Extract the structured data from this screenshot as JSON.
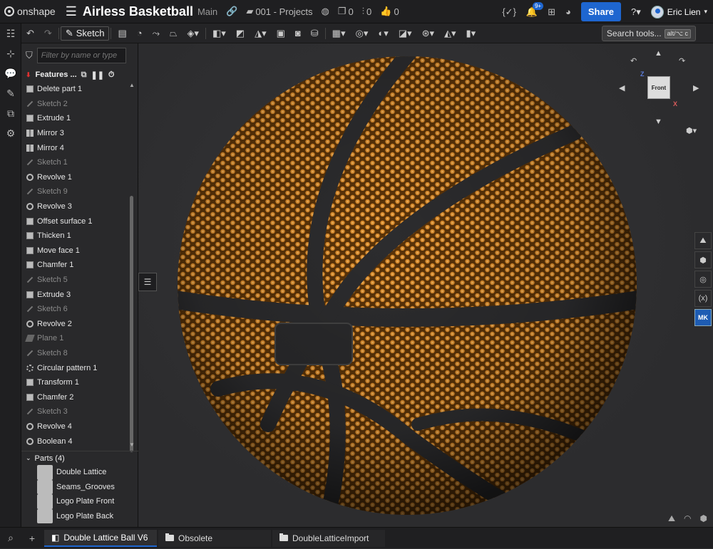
{
  "topbar": {
    "brand": "onshape",
    "doc_title": "Airless Basketball",
    "branch": "Main",
    "project": "001 - Projects",
    "counts": {
      "copies": "0",
      "versions": "0",
      "likes": "0"
    },
    "notifications": "9+",
    "share_label": "Share",
    "user_name": "Eric Lien"
  },
  "toolbar": {
    "sketch_label": "Sketch",
    "search_label": "Search tools...",
    "search_shortcut": "alt/⌥ c"
  },
  "panel": {
    "filter_placeholder": "Filter by name or type",
    "features_label": "Features ...",
    "features": [
      {
        "label": "Delete part 1",
        "type": "extrude",
        "dim": false
      },
      {
        "label": "Sketch 2",
        "type": "sketch",
        "dim": true
      },
      {
        "label": "Extrude 1",
        "type": "extrude",
        "dim": false
      },
      {
        "label": "Mirror 3",
        "type": "mirror",
        "dim": false
      },
      {
        "label": "Mirror 4",
        "type": "mirror",
        "dim": false
      },
      {
        "label": "Sketch 1",
        "type": "sketch",
        "dim": true
      },
      {
        "label": "Revolve 1",
        "type": "revolve",
        "dim": false
      },
      {
        "label": "Sketch 9",
        "type": "sketch",
        "dim": true
      },
      {
        "label": "Revolve 3",
        "type": "revolve",
        "dim": false
      },
      {
        "label": "Offset surface 1",
        "type": "extrude",
        "dim": false
      },
      {
        "label": "Thicken 1",
        "type": "extrude",
        "dim": false
      },
      {
        "label": "Move face 1",
        "type": "extrude",
        "dim": false
      },
      {
        "label": "Chamfer 1",
        "type": "extrude",
        "dim": false
      },
      {
        "label": "Sketch 5",
        "type": "sketch",
        "dim": true
      },
      {
        "label": "Extrude 3",
        "type": "extrude",
        "dim": false
      },
      {
        "label": "Sketch 6",
        "type": "sketch",
        "dim": true
      },
      {
        "label": "Revolve 2",
        "type": "revolve",
        "dim": false
      },
      {
        "label": "Plane 1",
        "type": "plane",
        "dim": true
      },
      {
        "label": "Sketch 8",
        "type": "sketch",
        "dim": true
      },
      {
        "label": "Circular pattern 1",
        "type": "pattern",
        "dim": false
      },
      {
        "label": "Transform 1",
        "type": "extrude",
        "dim": false
      },
      {
        "label": "Chamfer 2",
        "type": "extrude",
        "dim": false
      },
      {
        "label": "Sketch 3",
        "type": "sketch",
        "dim": true
      },
      {
        "label": "Revolve 4",
        "type": "revolve",
        "dim": false
      },
      {
        "label": "Boolean 4",
        "type": "revolve",
        "dim": false
      }
    ],
    "parts_label": "Parts (4)",
    "parts": [
      "Double Lattice",
      "Seams_Grooves",
      "Logo Plate Front",
      "Logo Plate Back"
    ]
  },
  "viewcube": {
    "front_label": "Front",
    "axis_x": "X",
    "axis_z": "Z"
  },
  "right_tools": {
    "mk_label": "MK"
  },
  "tabs": [
    {
      "label": "Double Lattice Ball V6",
      "active": true
    },
    {
      "label": "Obsolete",
      "active": false
    },
    {
      "label": "DoubleLatticeImport",
      "active": false
    }
  ],
  "colors": {
    "accent": "#1e66d0",
    "ball_orange": "#c07a28",
    "seam": "#2c2c2e"
  }
}
